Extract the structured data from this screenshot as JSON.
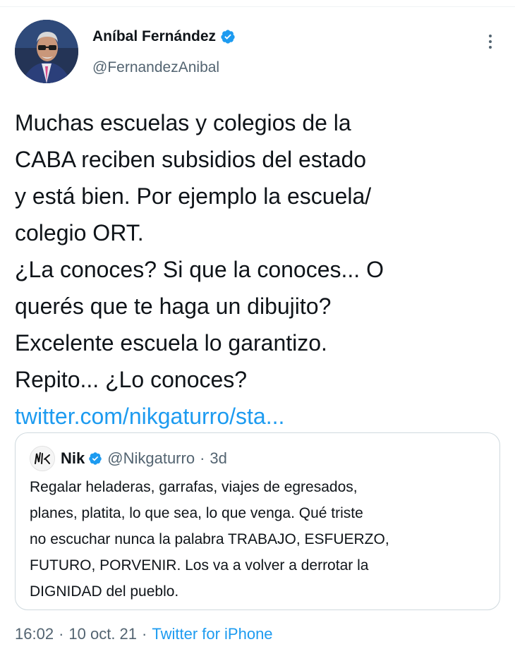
{
  "author": {
    "name": "Aníbal Fernández",
    "handle": "@FernandezAnibal"
  },
  "tweet": {
    "lines": [
      "Muchas escuelas y colegios de la",
      "CABA reciben subsidios del estado",
      "y está bien. Por ejemplo la escuela/",
      "colegio ORT.",
      "¿La conoces? Si que la conoces... O",
      "querés que te haga un dibujito?",
      "Excelente escuela lo garantizo.",
      "Repito... ¿Lo conoces?"
    ],
    "link": "twitter.com/nikgaturro/sta..."
  },
  "quote": {
    "name": "Nik",
    "handle": "@Nikgaturro",
    "time": "3d",
    "lines": [
      "Regalar heladeras, garrafas, viajes de egresados,",
      "planes, platita, lo que sea, lo que venga. Qué triste",
      "no escuchar nunca la palabra TRABAJO, ESFUERZO,",
      "FUTURO, PORVENIR. Los va a volver a derrotar la",
      "DIGNIDAD del pueblo."
    ]
  },
  "meta": {
    "time": "16:02",
    "date": "10 oct. 21",
    "source": "Twitter for iPhone",
    "dot": "·"
  },
  "colors": {
    "accent": "#1d9bf0",
    "secondary_text": "#536471",
    "border": "#cfd9de"
  },
  "icons": [
    "verified-badge-icon",
    "more-options-icon"
  ]
}
